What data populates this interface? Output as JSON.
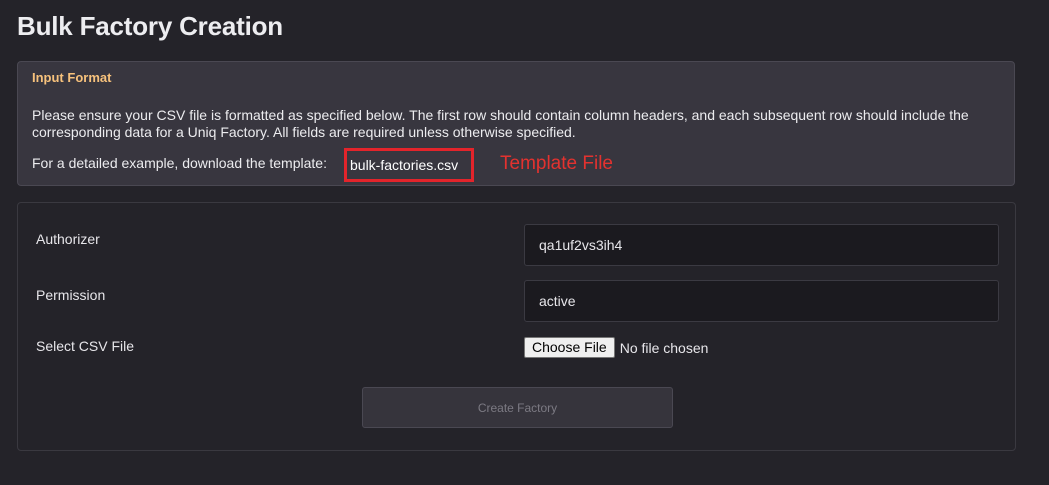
{
  "page": {
    "title": "Bulk Factory Creation"
  },
  "input_format": {
    "heading": "Input Format",
    "description": "Please ensure your CSV file is formatted as specified below. The first row should contain column headers, and each subsequent row should include the corresponding data for a Uniq Factory. All fields are required unless otherwise specified.",
    "template_prefix": "For a detailed example, download the template:",
    "template_link": "bulk-factories.csv",
    "annotation": "Template File"
  },
  "form": {
    "authorizer": {
      "label": "Authorizer",
      "value": "qa1uf2vs3ih4"
    },
    "permission": {
      "label": "Permission",
      "value": "active"
    },
    "csv_file": {
      "label": "Select CSV File",
      "button_label": "Choose File",
      "status": "No file chosen"
    },
    "submit_label": "Create Factory"
  },
  "colors": {
    "background": "#242329",
    "card": "#38363f",
    "heading_accent": "#f7c27c",
    "annotation_red": "#e3242b"
  }
}
